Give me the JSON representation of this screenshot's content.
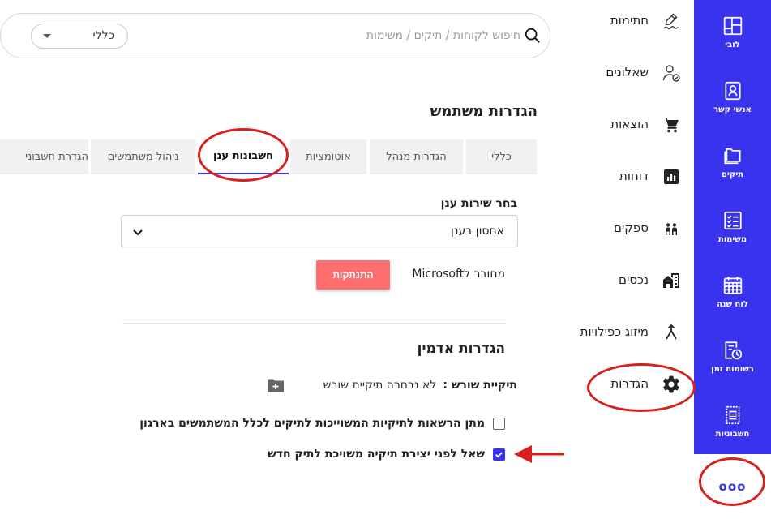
{
  "rail": {
    "items": [
      {
        "label": "לובי",
        "icon": "lobby-grid-icon"
      },
      {
        "label": "אנשי קשר",
        "icon": "contact-card-icon"
      },
      {
        "label": "תיקים",
        "icon": "folders-icon"
      },
      {
        "label": "משימות",
        "icon": "task-list-icon"
      },
      {
        "label": "לוח שנה",
        "icon": "calendar-icon"
      },
      {
        "label": "רשומות זמן",
        "icon": "time-records-icon"
      },
      {
        "label": "חשבוניות",
        "icon": "invoice-icon"
      }
    ],
    "more_label": "ooo"
  },
  "menu": {
    "items": [
      {
        "label": "חתימות",
        "icon": "signature-icon"
      },
      {
        "label": "שאלונים",
        "icon": "questionnaire-user-icon"
      },
      {
        "label": "הוצאות",
        "icon": "cart-icon"
      },
      {
        "label": "דוחות",
        "icon": "reports-chart-icon"
      },
      {
        "label": "ספקים",
        "icon": "suppliers-people-icon"
      },
      {
        "label": "נכסים",
        "icon": "property-building-icon"
      },
      {
        "label": "מיזוג כפילויות",
        "icon": "merge-arrows-icon"
      },
      {
        "label": "הגדרות",
        "icon": "gear-icon"
      }
    ]
  },
  "search": {
    "placeholder": "חיפוש לקוחות / תיקים / משימות",
    "scope_value": "כללי"
  },
  "page": {
    "title": "הגדרות משתמש"
  },
  "tabs": [
    {
      "label": "כללי",
      "active": false
    },
    {
      "label": "הגדרות מנהל",
      "active": false
    },
    {
      "label": "אוטומציות",
      "active": false
    },
    {
      "label": "חשבונות ענן",
      "active": true
    },
    {
      "label": "ניהול משתמשים",
      "active": false
    },
    {
      "label": "הגדרת חשבוני",
      "active": false
    }
  ],
  "cloud": {
    "label": "בחר שירות ענן",
    "selected": "אחסון בענן",
    "connected_text": "מחובר לMicrosoft",
    "disconnect_label": "התנתקות"
  },
  "admin": {
    "title": "הגדרות אדמין",
    "root_label": "תיקיית שורש :",
    "root_value": "לא נבחרה תיקיית שורש",
    "checkboxes": [
      {
        "label": "מתן הרשאות לתיקיות המשוייכות לתיקים לכלל המשתמשים בארגון",
        "checked": false
      },
      {
        "label": "שאל לפני יצירת תיקיה משויכת לתיק חדש",
        "checked": true
      }
    ]
  },
  "colors": {
    "brand": "#3a33ee",
    "danger_button": "#ff6e6e",
    "annotation": "#d8201e"
  }
}
